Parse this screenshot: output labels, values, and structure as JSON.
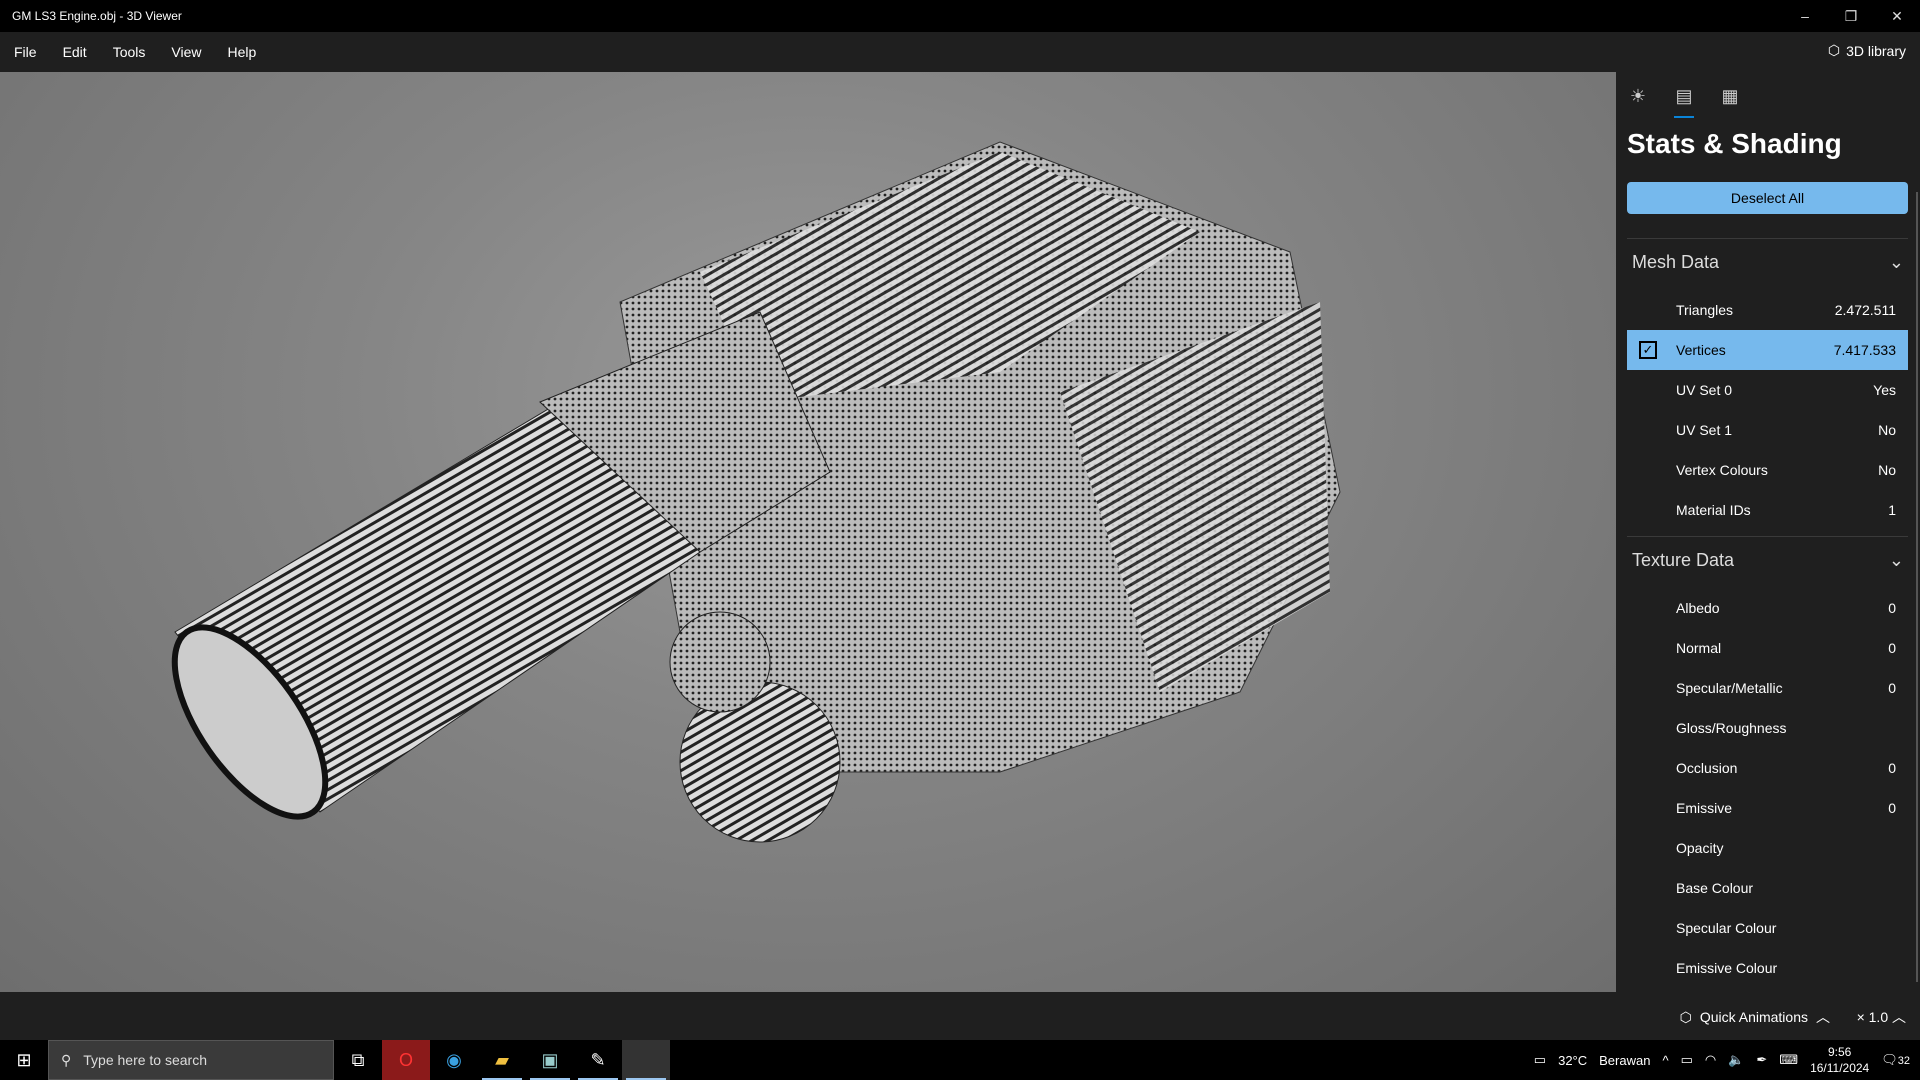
{
  "window": {
    "title": "GM LS3 Engine.obj - 3D Viewer",
    "min": "–",
    "restore": "❐",
    "close": "✕"
  },
  "menu": [
    "File",
    "Edit",
    "Tools",
    "View",
    "Help"
  ],
  "library_label": "3D library",
  "panel": {
    "title": "Stats & Shading",
    "deselect_label": "Deselect All",
    "mesh_header": "Mesh Data",
    "mesh_rows": [
      {
        "label": "Triangles",
        "value": "2.472.511",
        "selected": false
      },
      {
        "label": "Vertices",
        "value": "7.417.533",
        "selected": true
      },
      {
        "label": "UV Set 0",
        "value": "Yes"
      },
      {
        "label": "UV Set 1",
        "value": "No"
      },
      {
        "label": "Vertex Colours",
        "value": "No"
      },
      {
        "label": "Material IDs",
        "value": "1"
      }
    ],
    "texture_header": "Texture Data",
    "texture_rows": [
      {
        "label": "Albedo",
        "value": "0"
      },
      {
        "label": "Normal",
        "value": "0"
      },
      {
        "label": "Specular/Metallic",
        "value": "0"
      },
      {
        "label": "Gloss/Roughness",
        "value": ""
      },
      {
        "label": "Occlusion",
        "value": "0"
      },
      {
        "label": "Emissive",
        "value": "0"
      },
      {
        "label": "Opacity",
        "value": ""
      },
      {
        "label": "Base Colour",
        "value": ""
      },
      {
        "label": "Specular Colour",
        "value": ""
      },
      {
        "label": "Emissive Colour",
        "value": ""
      }
    ]
  },
  "bottom": {
    "quick_animations": "Quick Animations",
    "speed": "× 1.0"
  },
  "taskbar": {
    "search_placeholder": "Type here to search",
    "weather_temp": "32°C",
    "weather_desc": "Berawan",
    "time": "9:56",
    "date": "16/11/2024",
    "notifications": "32"
  },
  "colors": {
    "accent": "#76b9ed",
    "tab_underline": "#0a84d8"
  }
}
